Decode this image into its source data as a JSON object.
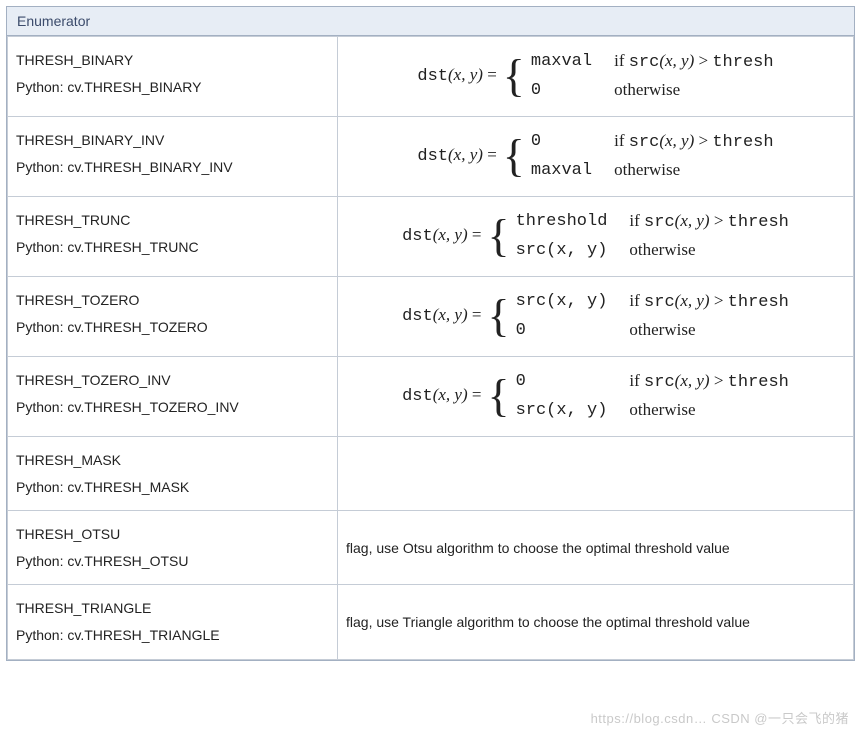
{
  "header": "Enumerator",
  "python_prefix": "Python: ",
  "formula_lhs": {
    "fn": "dst",
    "args": "(x, y)",
    "eq": " = "
  },
  "cond_prefix": "if ",
  "cond_srcfn": "src",
  "cond_args": "(x, y)",
  "cond_rel": " > ",
  "cond_thresh": "thresh",
  "otherwise": "otherwise",
  "rows": [
    {
      "name": "THRESH_BINARY",
      "py": "cv.THRESH_BINARY",
      "v1": "maxval",
      "v2": "0"
    },
    {
      "name": "THRESH_BINARY_INV",
      "py": "cv.THRESH_BINARY_INV",
      "v1": "0",
      "v2": "maxval"
    },
    {
      "name": "THRESH_TRUNC",
      "py": "cv.THRESH_TRUNC",
      "v1": "threshold",
      "v2": "src(x, y)"
    },
    {
      "name": "THRESH_TOZERO",
      "py": "cv.THRESH_TOZERO",
      "v1": "src(x, y)",
      "v2": "0"
    },
    {
      "name": "THRESH_TOZERO_INV",
      "py": "cv.THRESH_TOZERO_INV",
      "v1": "0",
      "v2": "src(x, y)"
    }
  ],
  "text_rows": [
    {
      "name": "THRESH_MASK",
      "py": "cv.THRESH_MASK",
      "desc": ""
    },
    {
      "name": "THRESH_OTSU",
      "py": "cv.THRESH_OTSU",
      "desc": "flag, use Otsu algorithm to choose the optimal threshold value"
    },
    {
      "name": "THRESH_TRIANGLE",
      "py": "cv.THRESH_TRIANGLE",
      "desc": "flag, use Triangle algorithm to choose the optimal threshold value"
    }
  ],
  "watermark": "https://blog.csdn… CSDN @一只会飞的猪"
}
